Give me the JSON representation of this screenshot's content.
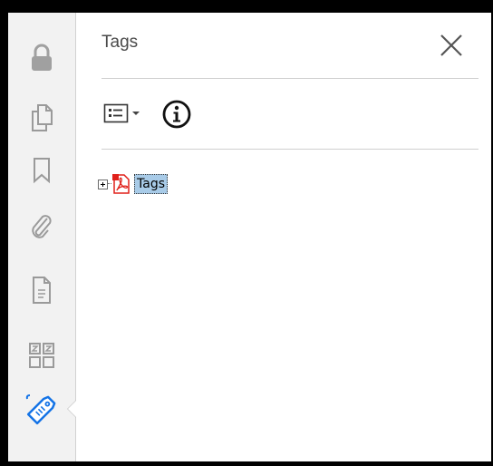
{
  "panel": {
    "title": "Tags"
  },
  "tree": {
    "root_label": "Tags"
  },
  "rail": {
    "items": [
      {
        "icon": "lock-icon"
      },
      {
        "icon": "pages-icon"
      },
      {
        "icon": "bookmark-icon"
      },
      {
        "icon": "attachment-icon"
      },
      {
        "icon": "document-icon"
      },
      {
        "icon": "content-icon"
      },
      {
        "icon": "tag-icon",
        "active": true
      }
    ]
  },
  "colors": {
    "rail_icon": "#9a9a9a",
    "active_icon": "#1473e6",
    "selection": "#a8cbe8",
    "pdf_red": "#e0201a"
  }
}
